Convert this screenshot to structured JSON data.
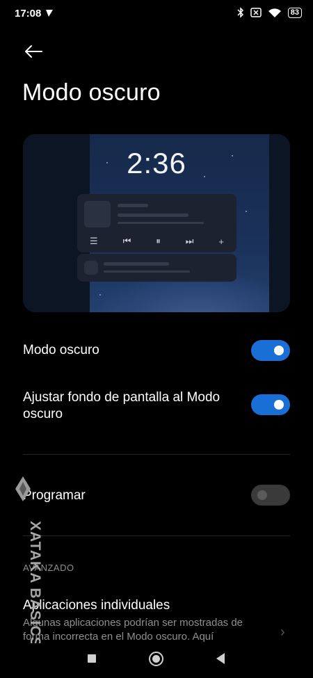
{
  "status_bar": {
    "time": "17:08",
    "battery": "83"
  },
  "header": {
    "title": "Modo oscuro"
  },
  "preview": {
    "clock": "2:36"
  },
  "settings": {
    "dark_mode": {
      "label": "Modo oscuro",
      "enabled": true
    },
    "adjust_wallpaper": {
      "label_line1": "Ajustar fondo de pantalla al Modo",
      "label_line2": "oscuro",
      "enabled": true
    },
    "schedule": {
      "label": "Programar",
      "enabled": false
    }
  },
  "advanced": {
    "section_label": "AVANZADO",
    "item_title": "Aplicaciones individuales",
    "item_subtitle": "Algunas aplicaciones podrían ser mostradas de forma incorrecta en el Modo oscuro. Aquí"
  },
  "watermark": {
    "text": "XATAKA BASICS"
  },
  "colors": {
    "accent": "#1a6fd6",
    "background": "#000000",
    "secondary_text": "#8f8f8f"
  },
  "icons": [
    "bluetooth-icon",
    "no-sim-icon",
    "wifi-icon",
    "battery-icon",
    "back-arrow-icon",
    "chevron-right-icon"
  ]
}
